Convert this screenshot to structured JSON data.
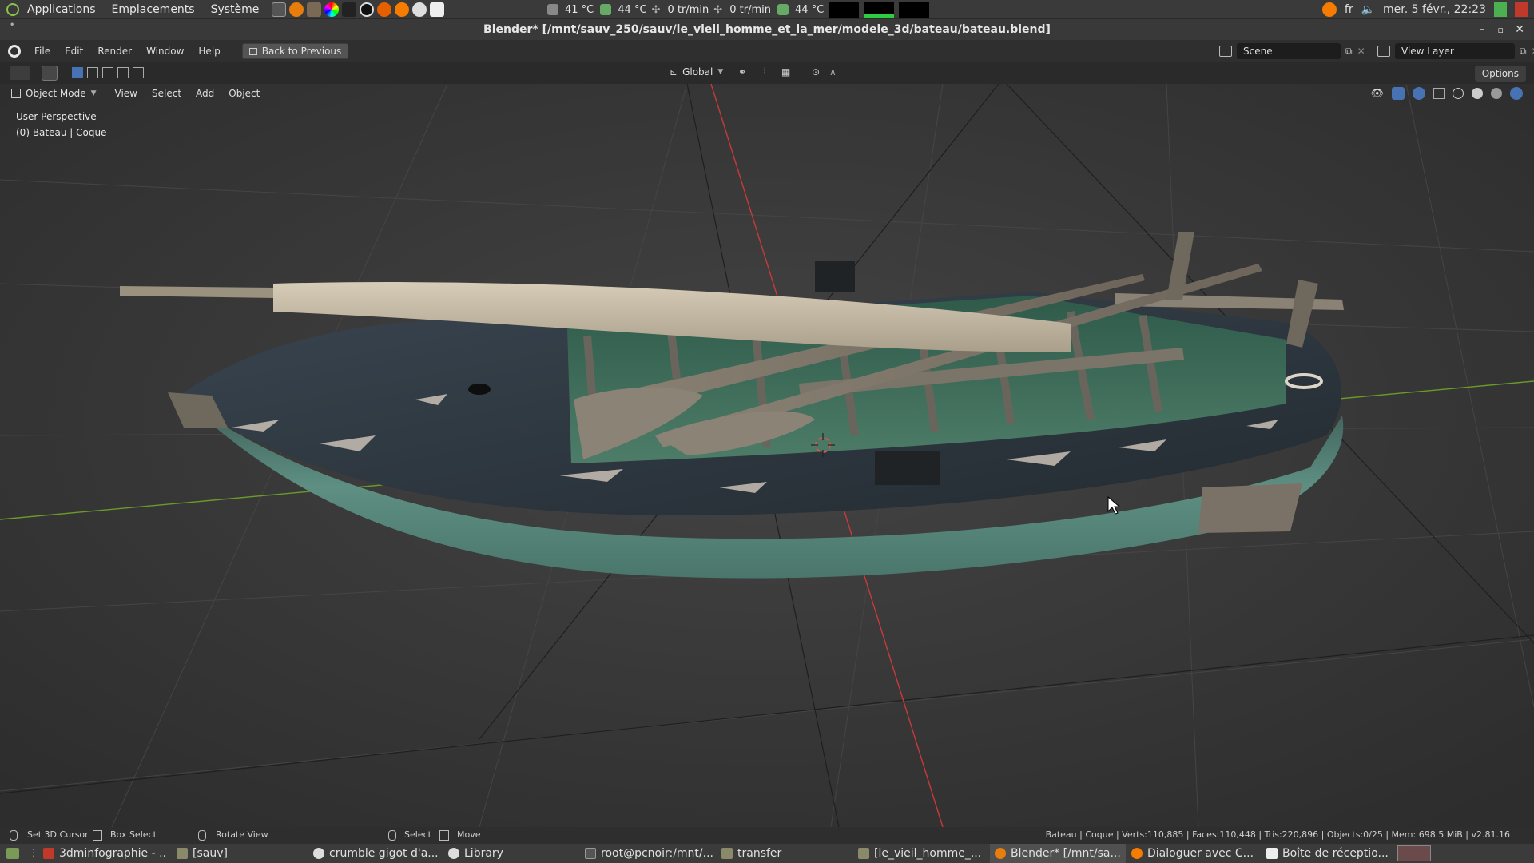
{
  "system_panel": {
    "menus": [
      "Applications",
      "Emplacements",
      "Système"
    ],
    "sensors": [
      "41 °C",
      "44 °C",
      "0 tr/min",
      "0 tr/min",
      "44 °C"
    ],
    "keyboard_layout": "fr",
    "datetime": "mer. 5 févr., 22:23"
  },
  "window": {
    "title": "Blender* [/mnt/sauv_250/sauv/le_vieil_homme_et_la_mer/modele_3d/bateau/bateau.blend]"
  },
  "topbar": {
    "menus": [
      "File",
      "Edit",
      "Render",
      "Window",
      "Help"
    ],
    "back_button": "Back to Previous",
    "scene": "Scene",
    "view_layer": "View Layer"
  },
  "tool_header": {
    "transform_orientation": "Global",
    "options_label": "Options"
  },
  "viewport_header": {
    "mode": "Object Mode",
    "menus": [
      "View",
      "Select",
      "Add",
      "Object"
    ]
  },
  "viewport": {
    "perspective_label": "User Perspective",
    "object_label": "(0) Bateau | Coque"
  },
  "statusbar": {
    "hints": [
      "Set 3D Cursor",
      "Box Select",
      "Rotate View",
      "Select",
      "Move"
    ],
    "stats": "Bateau | Coque | Verts:110,885 | Faces:110,448 | Tris:220,896 | Objects:0/25 | Mem: 698.5 MiB | v2.81.16"
  },
  "taskbar": {
    "tasks": [
      "3dminfographie - ...",
      "[sauv]",
      "crumble gigot d'a...",
      "Library",
      "root@pcnoir:/mnt/...",
      "transfer",
      "[le_vieil_homme_...",
      "Blender* [/mnt/sa...",
      "Dialoguer avec C...",
      "Boîte de réceptio..."
    ]
  },
  "colors": {
    "accent": "#4772b3",
    "x_axis": "#c83a3a",
    "y_axis": "#6b9a2a",
    "hull_green": "#5e8f82",
    "hull_dark": "#2f3940"
  }
}
